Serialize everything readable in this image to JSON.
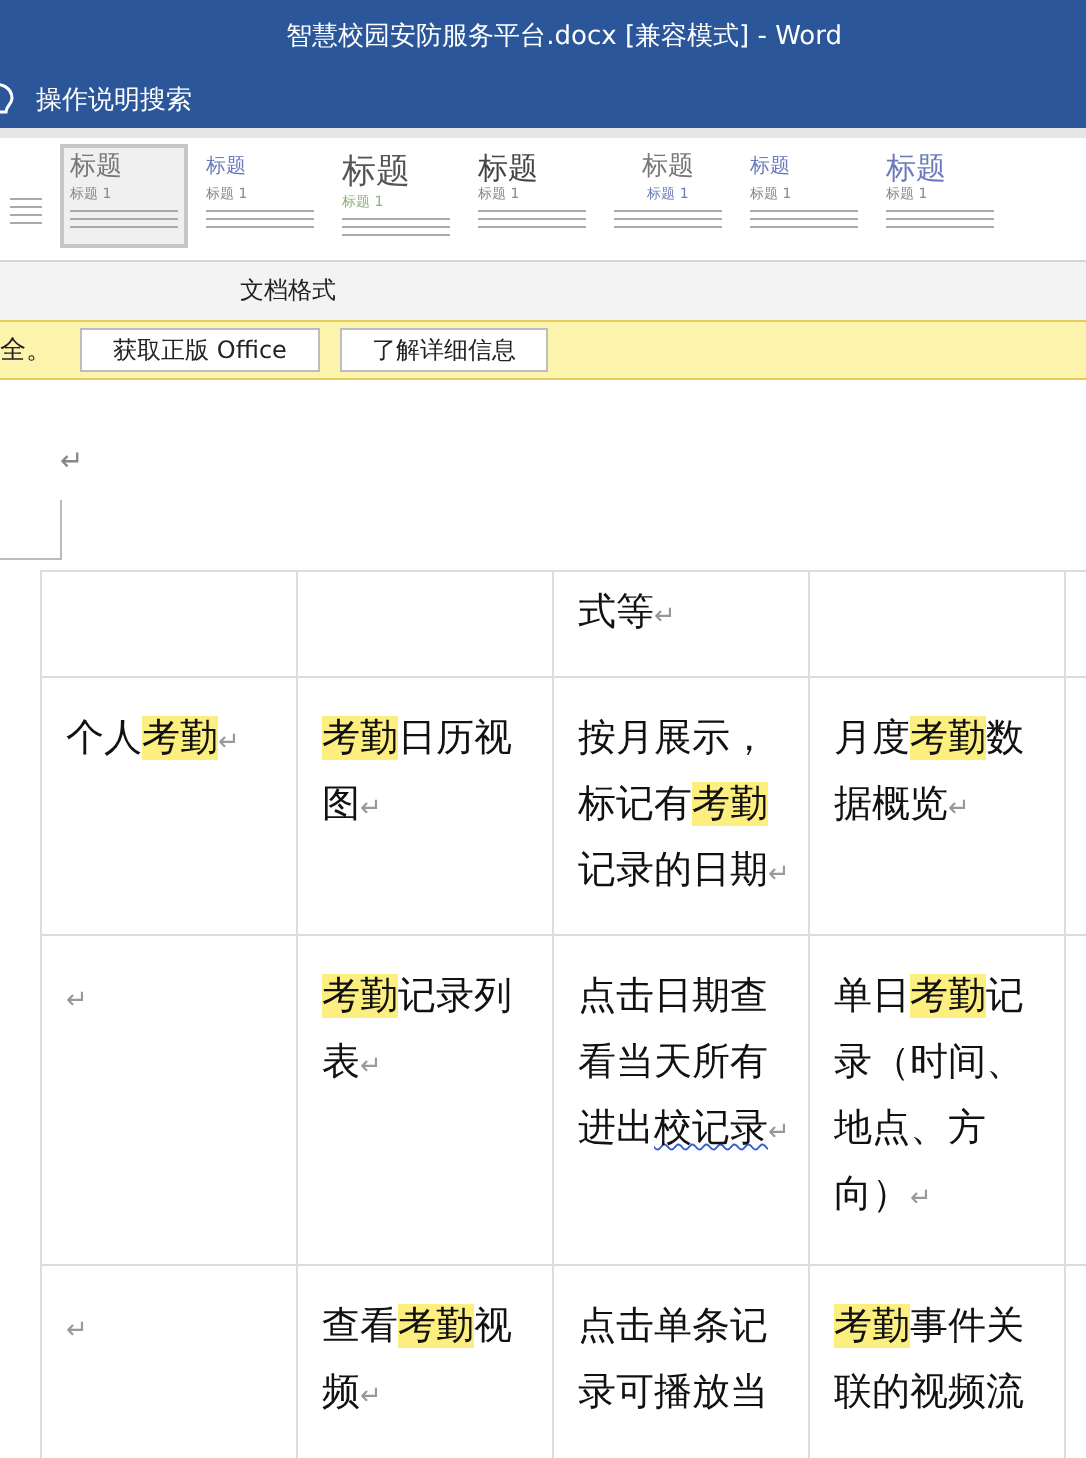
{
  "window": {
    "title": "智慧校园安防服务平台.docx [兼容模式]  -  Word"
  },
  "tell_me": {
    "label": "操作说明搜索"
  },
  "style_gallery": {
    "items": [
      {
        "title": "标题",
        "subtitle": "标题 1",
        "selected": true
      },
      {
        "title": "标题",
        "subtitle": "标题 1",
        "selected": false
      },
      {
        "title": "标题",
        "subtitle": "标题 1",
        "selected": false
      },
      {
        "title": "标题",
        "subtitle": "标题 1",
        "selected": false
      },
      {
        "title": "标题",
        "subtitle": "标题 1",
        "selected": false
      },
      {
        "title": "标题",
        "subtitle": "标题 1",
        "selected": false
      },
      {
        "title": "标题",
        "subtitle": "标题 1",
        "selected": false
      }
    ],
    "group_label": "文档格式"
  },
  "message_bar": {
    "text": "全。",
    "buttons": [
      "获取正版 Office",
      "了解详细信息"
    ]
  },
  "document": {
    "paragraph_mark": "↵",
    "table": {
      "rows": [
        {
          "cells": [
            {},
            {},
            {
              "segments": [
                {
                  "text": "式等",
                  "highlight": false,
                  "spell_error": false
                }
              ],
              "mark": "↵"
            },
            {}
          ]
        },
        {
          "cells": [
            {
              "segments": [
                {
                  "text": "个人",
                  "highlight": false,
                  "spell_error": false
                },
                {
                  "text": "考勤",
                  "highlight": true,
                  "spell_error": false
                }
              ],
              "mark": "↵"
            },
            {
              "segments": [
                {
                  "text": "考勤",
                  "highlight": true,
                  "spell_error": false
                },
                {
                  "text": "日历视图",
                  "highlight": false,
                  "spell_error": false
                }
              ],
              "mark": "↵"
            },
            {
              "segments": [
                {
                  "text": "按月展示，标记有",
                  "highlight": false,
                  "spell_error": false
                },
                {
                  "text": "考勤",
                  "highlight": true,
                  "spell_error": false
                },
                {
                  "text": "记录的日期",
                  "highlight": false,
                  "spell_error": false
                }
              ],
              "mark": "↵"
            },
            {
              "segments": [
                {
                  "text": "月度",
                  "highlight": false,
                  "spell_error": false
                },
                {
                  "text": "考勤",
                  "highlight": true,
                  "spell_error": false
                },
                {
                  "text": "数据概览",
                  "highlight": false,
                  "spell_error": false
                }
              ],
              "mark": "↵"
            }
          ]
        },
        {
          "cells": [
            {
              "mark": "↵"
            },
            {
              "segments": [
                {
                  "text": "考勤",
                  "highlight": true,
                  "spell_error": false
                },
                {
                  "text": "记录列表",
                  "highlight": false,
                  "spell_error": false
                }
              ],
              "mark": "↵"
            },
            {
              "segments": [
                {
                  "text": "点击日期查看当天所有进出",
                  "highlight": false,
                  "spell_error": false
                },
                {
                  "text": "校记录",
                  "highlight": false,
                  "spell_error": true
                }
              ],
              "mark": "↵"
            },
            {
              "segments": [
                {
                  "text": "单日",
                  "highlight": false,
                  "spell_error": false
                },
                {
                  "text": "考勤",
                  "highlight": true,
                  "spell_error": false
                },
                {
                  "text": "记录（时间、地点、方向）",
                  "highlight": false,
                  "spell_error": false
                }
              ],
              "mark": "↵"
            }
          ]
        },
        {
          "cells": [
            {
              "mark": "↵"
            },
            {
              "segments": [
                {
                  "text": "查看",
                  "highlight": false,
                  "spell_error": false
                },
                {
                  "text": "考勤",
                  "highlight": true,
                  "spell_error": false
                },
                {
                  "text": "视频",
                  "highlight": false,
                  "spell_error": false
                }
              ],
              "mark": "↵"
            },
            {
              "segments": [
                {
                  "text": "点击单条记录可播放当",
                  "highlight": false,
                  "spell_error": false
                }
              ]
            },
            {
              "segments": [
                {
                  "text": "考勤",
                  "highlight": true,
                  "spell_error": false
                },
                {
                  "text": "事件关联的视频流",
                  "highlight": false,
                  "spell_error": false
                }
              ]
            }
          ]
        }
      ]
    }
  }
}
